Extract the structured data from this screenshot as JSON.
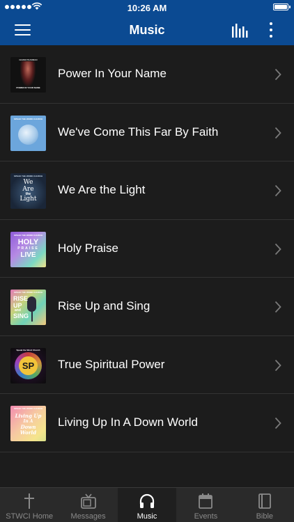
{
  "status_bar": {
    "time": "10:26 AM"
  },
  "header": {
    "title": "Music"
  },
  "albums": [
    {
      "title": "Power In Your Name",
      "thumb_texts": [
        "NAOMI PEARMAN",
        "POWER IN YOUR NAME"
      ]
    },
    {
      "title": "We've Come This Far By Faith",
      "thumb_texts": [
        "SPEAK THE WORD CHURCH"
      ]
    },
    {
      "title": "We Are the Light",
      "thumb_texts": [
        "SPEAK THE WORD CHURCH",
        "We",
        "Are",
        "the",
        "Light"
      ]
    },
    {
      "title": "Holy Praise",
      "thumb_texts": [
        "SPEAK THE WORD CHURCH",
        "HOLY",
        "PRAISE",
        "LIVE"
      ]
    },
    {
      "title": "Rise Up and Sing",
      "thumb_texts": [
        "SPEAK THE WORD CHURCH",
        "RISE",
        "UP",
        "and",
        "SING"
      ]
    },
    {
      "title": "True Spiritual Power",
      "thumb_texts": [
        "Speak the Word Church",
        "SP"
      ]
    },
    {
      "title": "Living Up In A Down World",
      "thumb_texts": [
        "SPEAK THE WORD CHURCH",
        "Living Up",
        "In A",
        "Down",
        "World"
      ]
    }
  ],
  "tabs": [
    {
      "label": "STWCI Home",
      "icon": "cross-icon",
      "active": false
    },
    {
      "label": "Messages",
      "icon": "tv-icon",
      "active": false
    },
    {
      "label": "Music",
      "icon": "headphones-icon",
      "active": true
    },
    {
      "label": "Events",
      "icon": "calendar-icon",
      "active": false
    },
    {
      "label": "Bible",
      "icon": "book-icon",
      "active": false
    }
  ],
  "colors": {
    "header": "#0b4a92",
    "background": "#1c1c1c",
    "tabbar": "#2a2a2a"
  }
}
